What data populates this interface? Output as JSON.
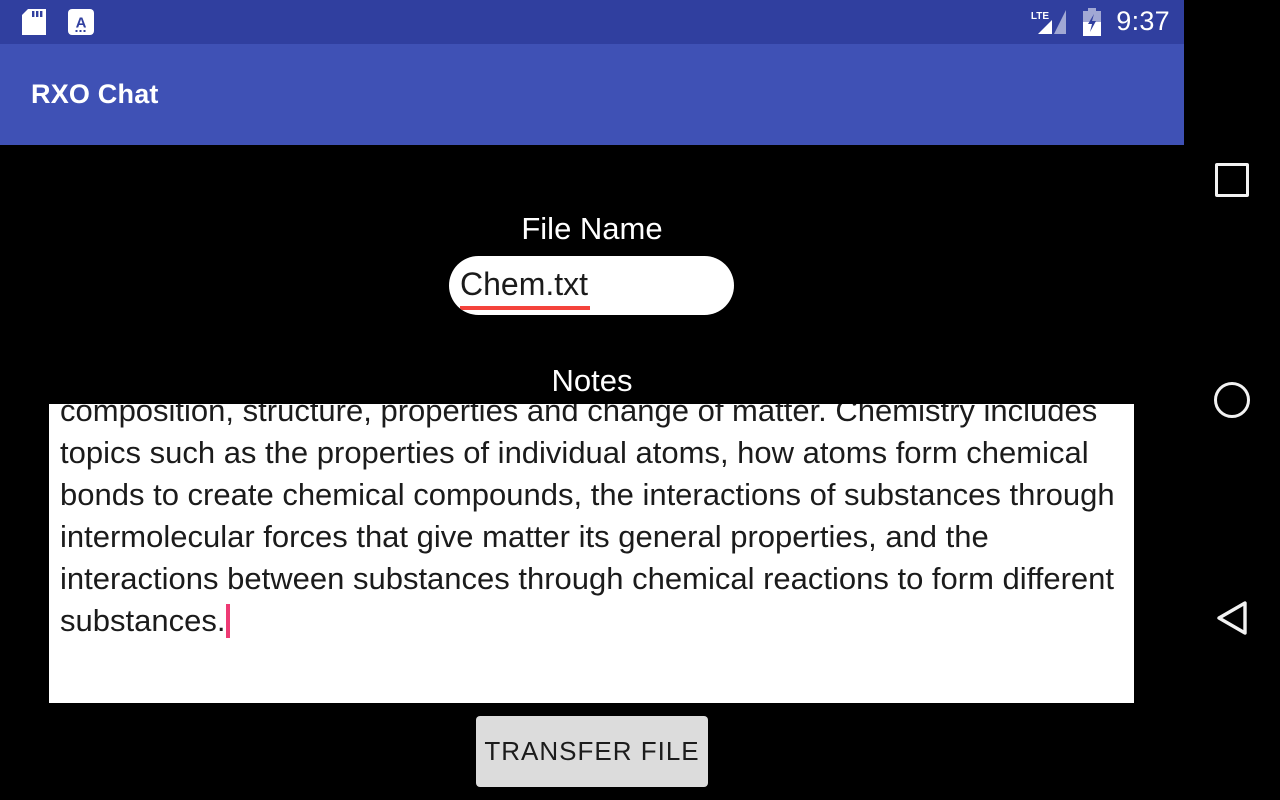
{
  "status_bar": {
    "time": "9:37",
    "network_label": "LTE",
    "icons": [
      {
        "name": "sd-card-icon"
      },
      {
        "name": "keyboard-input-method-icon",
        "glyph": "A"
      },
      {
        "name": "lte-signal-icon"
      },
      {
        "name": "battery-charging-icon"
      }
    ],
    "background_color": "#303F9F"
  },
  "app_bar": {
    "title": "RXO Chat",
    "background_color": "#3F51B5",
    "text_color": "#FFFFFF"
  },
  "form": {
    "file_name": {
      "label": "File Name",
      "value": "Chem.txt",
      "placeholder": "File Name",
      "spellcheck_underline_color": "#F4433C"
    },
    "notes": {
      "label": "Notes",
      "value": "composition, structure, properties and change of matter. Chemistry includes topics such as the properties of individual atoms, how atoms form chemical bonds to create chemical compounds, the interactions of substances through intermolecular forces that give matter its general properties, and the interactions between substances through chemical reactions to form different substances.",
      "placeholder": "Notes",
      "caret_color": "#EE3A74",
      "scrolled": true
    },
    "transfer_button": {
      "label": "TRANSFER FILE",
      "background_color": "#DCDCDC",
      "text_color": "#1C1C1C"
    }
  },
  "navigation_bar": {
    "buttons": [
      {
        "name": "recents-button",
        "icon": "square-icon"
      },
      {
        "name": "home-button",
        "icon": "circle-icon"
      },
      {
        "name": "back-button",
        "icon": "triangle-left-icon"
      }
    ],
    "background_color": "#000000"
  }
}
